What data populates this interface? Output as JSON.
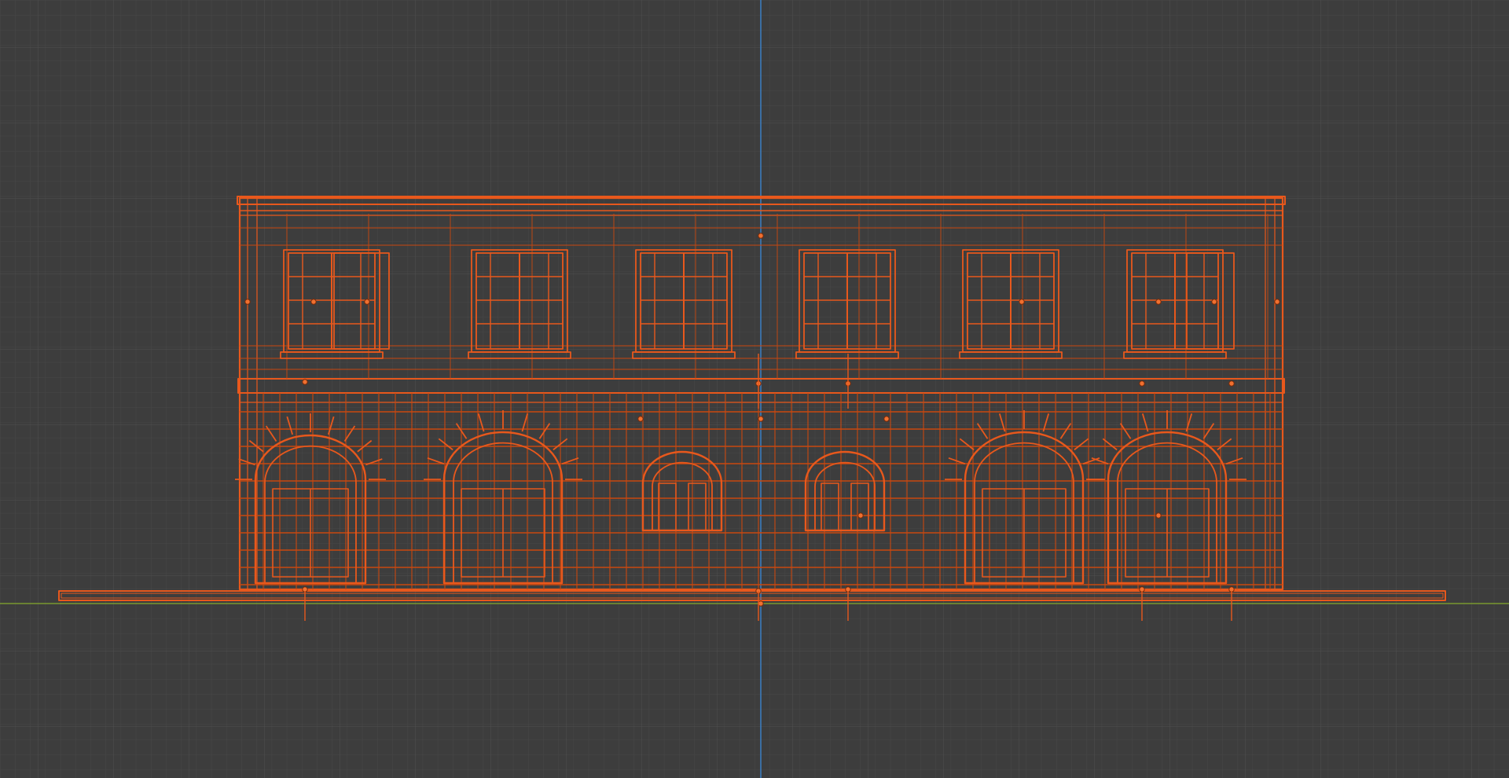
{
  "viewport": {
    "view": "front-orthographic",
    "shading": "wireframe",
    "grid": true,
    "selection": "all-selected"
  },
  "colors": {
    "background": "#3d3d3d",
    "grid_minor": "#484848",
    "grid_major": "#525252",
    "x_axis": "#7a9a2f",
    "z_axis": "#3b7fc4",
    "wire_selected": "#e8581c",
    "wire_dense": "#c9480f",
    "origin_dot": "#f07030"
  },
  "model": {
    "name": "building-facade",
    "upper_windows": 6,
    "ground_arches": 6
  }
}
